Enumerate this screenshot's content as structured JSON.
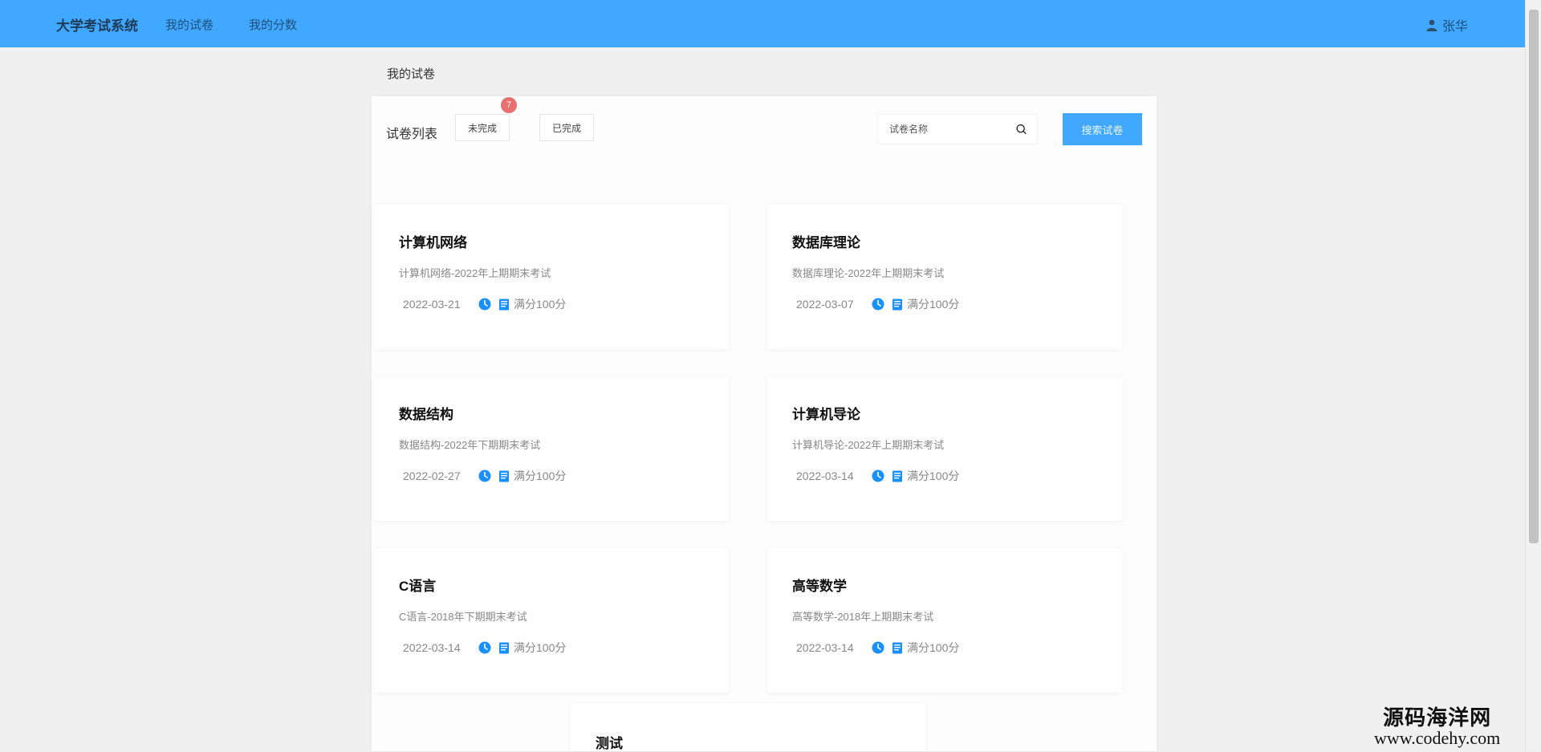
{
  "header": {
    "brand": "大学考试系统",
    "nav": [
      "我的试卷",
      "我的分数"
    ],
    "user_name": "张华"
  },
  "breadcrumb": "我的试卷",
  "toolbar": {
    "list_label": "试卷列表",
    "filter_undone": "未完成",
    "filter_done": "已完成",
    "undone_count": "7",
    "search_placeholder": "试卷名称",
    "search_value": "",
    "search_button": "搜索试卷"
  },
  "papers": [
    {
      "title": "计算机网络",
      "desc": "计算机网络-2022年上期期末考试",
      "date": "2022-03-21",
      "score": "满分100分"
    },
    {
      "title": "数据库理论",
      "desc": "数据库理论-2022年上期期末考试",
      "date": "2022-03-07",
      "score": "满分100分"
    },
    {
      "title": "数据结构",
      "desc": "数据结构-2022年下期期末考试",
      "date": "2022-02-27",
      "score": "满分100分"
    },
    {
      "title": "计算机导论",
      "desc": "计算机导论-2022年上期期末考试",
      "date": "2022-03-14",
      "score": "满分100分"
    },
    {
      "title": "C语言",
      "desc": "C语言-2018年下期期末考试",
      "date": "2022-03-14",
      "score": "满分100分"
    },
    {
      "title": "高等数学",
      "desc": "高等数学-2018年上期期末考试",
      "date": "2022-03-14",
      "score": "满分100分"
    },
    {
      "title": "测试",
      "desc": "",
      "date": "",
      "score": ""
    }
  ],
  "watermark": {
    "cn": "源码海洋网",
    "en": "www.codehy.com"
  },
  "colors": {
    "header_bg": "#40a9ff",
    "accent": "#40a9ff",
    "badge": "#e8706f",
    "icon_blue": "#1890ff",
    "page_bg": "#f0f0f0"
  },
  "icons": {
    "user": "user-icon",
    "search": "search-icon",
    "date": "clock-icon",
    "score": "document-icon"
  }
}
